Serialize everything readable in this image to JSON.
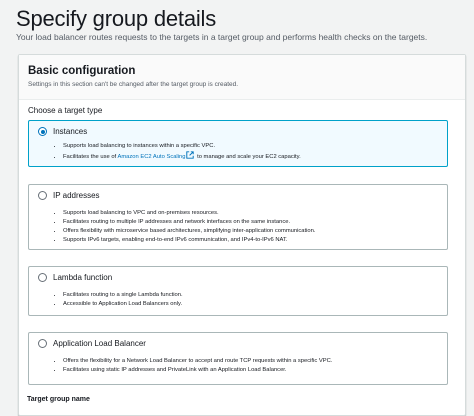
{
  "page": {
    "title": "Specify group details",
    "description": "Your load balancer routes requests to the targets in a target group and performs health checks on the targets."
  },
  "basic_config": {
    "title": "Basic configuration",
    "subtitle": "Settings in this section can't be changed after the target group is created.",
    "target_type_label": "Choose a target type",
    "options": [
      {
        "label": "Instances",
        "selected": true,
        "bullets": [
          "Supports load balancing to instances within a specific VPC.",
          "Facilitates the use of "
        ],
        "link_text": "Amazon EC2 Auto Scaling",
        "link_suffix": " to manage and scale your EC2 capacity."
      },
      {
        "label": "IP addresses",
        "selected": false,
        "bullets": [
          "Supports load balancing to VPC and on-premises resources.",
          "Facilitates routing to multiple IP addresses and network interfaces on the same instance.",
          "Offers flexibility with microservice based architectures, simplifying inter-application communication.",
          "Supports IPv6 targets, enabling end-to-end IPv6 communication, and IPv4-to-IPv6 NAT."
        ]
      },
      {
        "label": "Lambda function",
        "selected": false,
        "bullets": [
          "Facilitates routing to a single Lambda function.",
          "Accessible to Application Load Balancers only."
        ]
      },
      {
        "label": "Application Load Balancer",
        "selected": false,
        "bullets": [
          "Offers the flexibility for a Network Load Balancer to accept and route TCP requests within a specific VPC.",
          "Facilitates using static IP addresses and PrivateLink with an Application Load Balancer."
        ]
      }
    ],
    "next_field_label": "Target group name"
  },
  "icons": {
    "external_link": "external-link-icon"
  },
  "colors": {
    "accent": "#0073bb",
    "selected_border": "#00a1c9",
    "selected_bg": "#f1faff"
  }
}
